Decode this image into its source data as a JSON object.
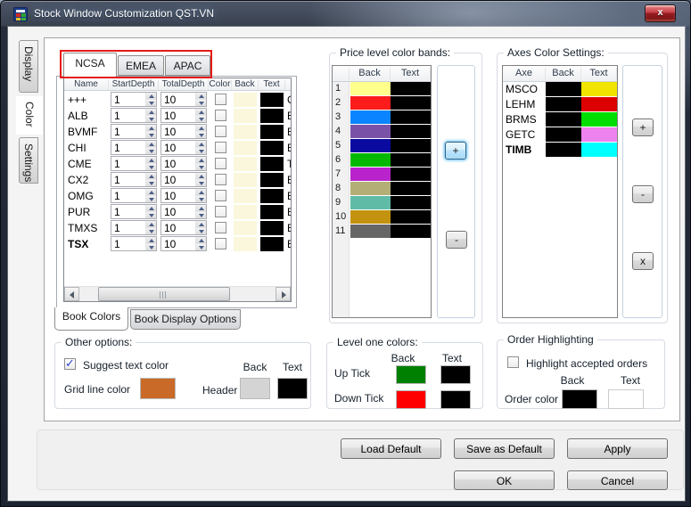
{
  "window": {
    "title": "Stock Window Customization QST.VN",
    "close_label": "x"
  },
  "side_tabs": [
    {
      "label": "Display",
      "selected": false
    },
    {
      "label": "Color",
      "selected": true
    },
    {
      "label": "Settings",
      "selected": false
    }
  ],
  "region_tabs": [
    {
      "label": "NCSA",
      "selected": true
    },
    {
      "label": "EMEA",
      "selected": false
    },
    {
      "label": "APAC",
      "selected": false
    }
  ],
  "book_table": {
    "columns": [
      "Name",
      "StartDepth",
      "TotalDepth",
      "Color",
      "Back",
      "Text"
    ],
    "rows": [
      {
        "name": "+++",
        "start": "1",
        "total": "10",
        "checked": false,
        "back": "#faf7dd",
        "text": "#000000",
        "font_clip": "C",
        "bold": false
      },
      {
        "name": "ALB",
        "start": "1",
        "total": "10",
        "checked": false,
        "back": "#faf7dd",
        "text": "#000000",
        "font_clip": "B",
        "bold": false
      },
      {
        "name": "BVMF",
        "start": "1",
        "total": "10",
        "checked": false,
        "back": "#faf7dd",
        "text": "#000000",
        "font_clip": "B",
        "bold": false
      },
      {
        "name": "CHI",
        "start": "1",
        "total": "10",
        "checked": false,
        "back": "#faf7dd",
        "text": "#000000",
        "font_clip": "B",
        "bold": false
      },
      {
        "name": "CME",
        "start": "1",
        "total": "10",
        "checked": false,
        "back": "#faf7dd",
        "text": "#000000",
        "font_clip": "To",
        "bold": false
      },
      {
        "name": "CX2",
        "start": "1",
        "total": "10",
        "checked": false,
        "back": "#faf7dd",
        "text": "#000000",
        "font_clip": "B",
        "bold": false
      },
      {
        "name": "OMG",
        "start": "1",
        "total": "10",
        "checked": false,
        "back": "#faf7dd",
        "text": "#000000",
        "font_clip": "B",
        "bold": false
      },
      {
        "name": "PUR",
        "start": "1",
        "total": "10",
        "checked": false,
        "back": "#faf7dd",
        "text": "#000000",
        "font_clip": "B",
        "bold": false
      },
      {
        "name": "TMXS",
        "start": "1",
        "total": "10",
        "checked": false,
        "back": "#faf7dd",
        "text": "#000000",
        "font_clip": "B",
        "bold": false
      },
      {
        "name": "TSX",
        "start": "1",
        "total": "10",
        "checked": false,
        "back": "#faf7dd",
        "text": "#000000",
        "font_clip": "B",
        "bold": true
      }
    ]
  },
  "bottom_tabs": [
    {
      "label": "Book Colors",
      "selected": true
    },
    {
      "label": "Book Display Options",
      "selected": false
    }
  ],
  "price_bands": {
    "title": "Price level color bands:",
    "columns": [
      "Back",
      "Text"
    ],
    "rows": [
      {
        "level": "1",
        "back": "#ffff8c",
        "text": "#000000"
      },
      {
        "level": "2",
        "back": "#fc1c1c",
        "text": "#000000"
      },
      {
        "level": "3",
        "back": "#0b84ff",
        "text": "#000000"
      },
      {
        "level": "4",
        "back": "#7952a8",
        "text": "#000000"
      },
      {
        "level": "5",
        "back": "#0a0aa0",
        "text": "#000000"
      },
      {
        "level": "6",
        "back": "#04b800",
        "text": "#000000"
      },
      {
        "level": "7",
        "back": "#b923cb",
        "text": "#000000"
      },
      {
        "level": "8",
        "back": "#b2ae76",
        "text": "#000000"
      },
      {
        "level": "9",
        "back": "#60bba6",
        "text": "#000000"
      },
      {
        "level": "10",
        "back": "#c3930f",
        "text": "#000000"
      },
      {
        "level": "11",
        "back": "#666666",
        "text": "#000000"
      }
    ],
    "add_label": "+",
    "remove_label": "-"
  },
  "axes_settings": {
    "title": "Axes Color Settings:",
    "columns": [
      "Axe",
      "Back",
      "Text"
    ],
    "rows": [
      {
        "axe": "MSCO",
        "back": "#000000",
        "text": "#f0e400",
        "bold": false
      },
      {
        "axe": "LEHM",
        "back": "#000000",
        "text": "#dd0000",
        "bold": false
      },
      {
        "axe": "BRMS",
        "back": "#000000",
        "text": "#00dd00",
        "bold": false
      },
      {
        "axe": "GETC",
        "back": "#000000",
        "text": "#ee82ee",
        "bold": false
      },
      {
        "axe": "TIMB",
        "back": "#000000",
        "text": "#00ffff",
        "bold": true
      }
    ],
    "add_label": "+",
    "remove_label": "-",
    "delete_label": "x"
  },
  "other_options": {
    "title": "Other options:",
    "suggest_label": "Suggest  text color",
    "suggest_checked": true,
    "grid_line_label": "Grid line color",
    "grid_line_color": "#c96a28",
    "back_header": "Back",
    "text_header": "Text",
    "header_label": "Header",
    "header_back": "#d4d4d4",
    "header_text": "#000000"
  },
  "level_one": {
    "title": "Level one colors:",
    "back_header": "Back",
    "text_header": "Text",
    "rows": [
      {
        "label": "Up Tick",
        "back": "#008000",
        "text": "#000000"
      },
      {
        "label": "Down Tick",
        "back": "#ff0000",
        "text": "#000000"
      }
    ]
  },
  "order_highlighting": {
    "title": "Order Highlighting",
    "highlight_label": "Highlight accepted orders",
    "highlight_checked": false,
    "back_header": "Back",
    "text_header": "Text",
    "order_color_label": "Order color",
    "order_back": "#000000",
    "order_text": "#ffffff"
  },
  "footer_buttons": {
    "load_default": "Load Default",
    "save_as_default": "Save as Default",
    "apply": "Apply",
    "ok": "OK",
    "cancel": "Cancel"
  }
}
